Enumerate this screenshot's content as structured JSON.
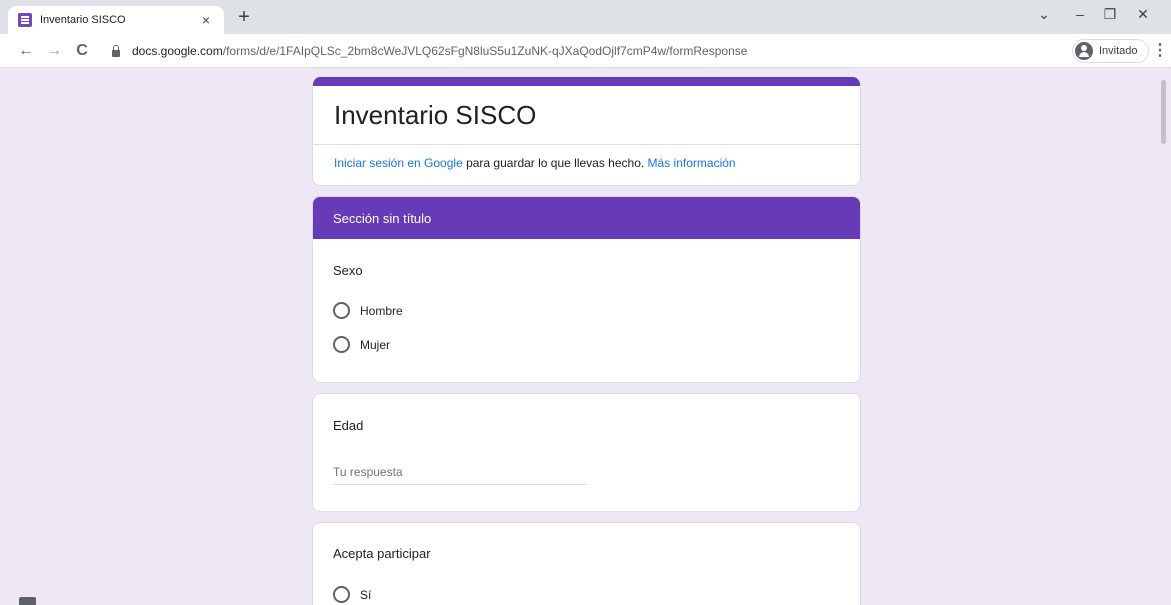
{
  "browser": {
    "tab_title": "Inventario SISCO",
    "tab_close": "×",
    "new_tab": "+",
    "url_domain": "docs.google.com",
    "url_path": "/forms/d/e/1FAIpQLSc_2bm8cWeJVLQ62sFgN8luS5u1ZuNK-qJXaQodOjlf7cmP4w/formResponse",
    "profile_name": "Invitado",
    "back": "←",
    "forward": "→",
    "reload": "C",
    "menu": "⋮",
    "win_dropdown": "⌄",
    "win_minimize": "–",
    "win_restore": "❐",
    "win_close": "✕"
  },
  "form": {
    "title": "Inventario SISCO",
    "signin_link": "Iniciar sesión en Google",
    "signin_text": " para guardar lo que llevas hecho. ",
    "more_info_link": "Más información",
    "accent_color": "#673ab7",
    "section_title": "Sección sin título",
    "questions": {
      "sexo": {
        "label": "Sexo",
        "options": [
          "Hombre",
          "Mujer"
        ]
      },
      "edad": {
        "label": "Edad",
        "placeholder": "Tu respuesta"
      },
      "acepta": {
        "label": "Acepta participar",
        "options": [
          "Sí"
        ]
      }
    }
  }
}
